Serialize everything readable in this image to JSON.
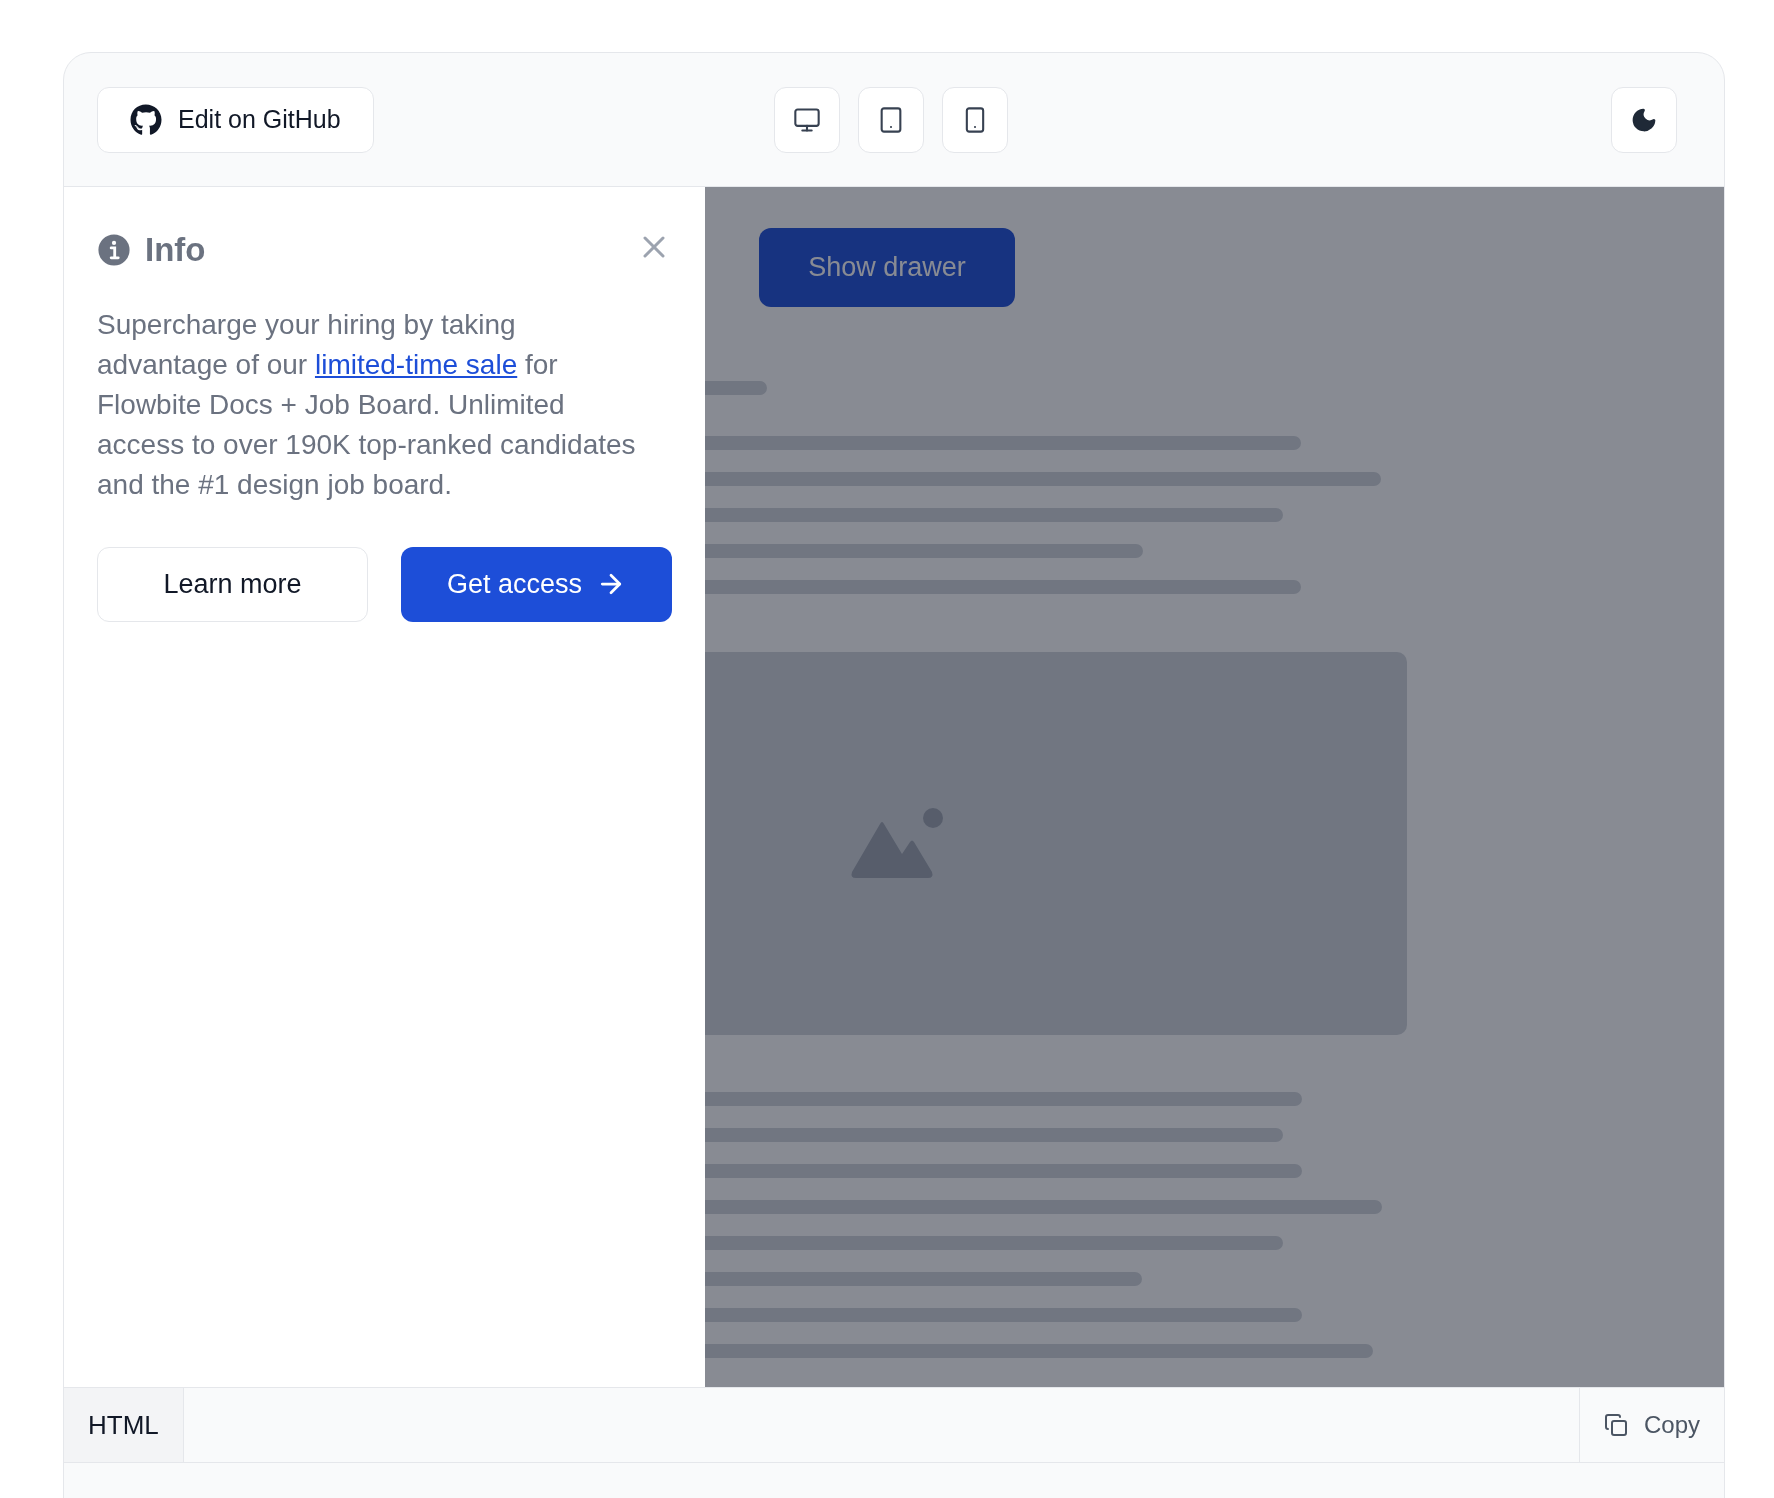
{
  "toolbar": {
    "edit_button": "Edit on GitHub"
  },
  "drawer": {
    "title": "Info",
    "text_before": "Supercharge your hiring by taking advantage of our ",
    "link": "limited-time sale",
    "text_after": " for Flowbite Docs + Job Board. Unlimited access to over 190K top-ranked candidates and the #1 design job board.",
    "secondary_button": "Learn more",
    "primary_button": "Get access"
  },
  "preview": {
    "button": "Show drawer"
  },
  "code_bar": {
    "tabs": [
      {
        "label": "HTML",
        "selected": true
      }
    ],
    "copy_button": "Copy"
  }
}
